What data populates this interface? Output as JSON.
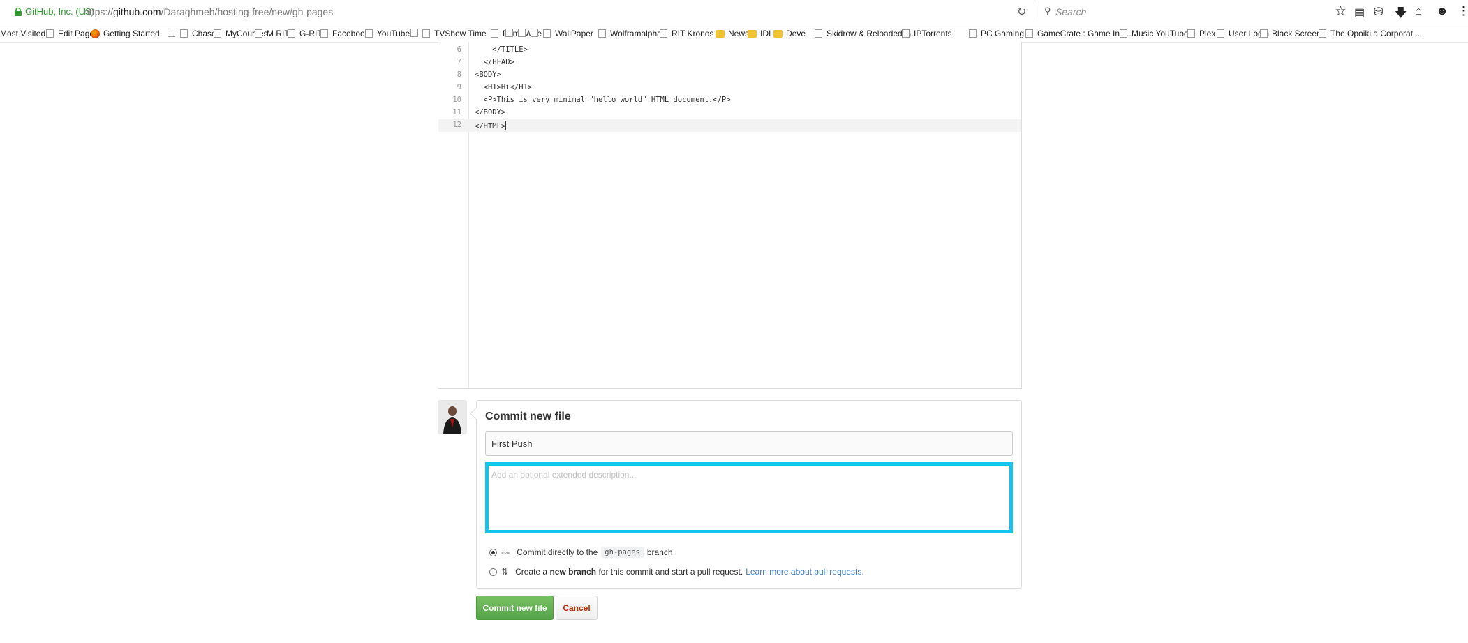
{
  "browser": {
    "site_identity": "GitHub, Inc. (US)",
    "url_prefix": "https://",
    "url_host": "github.com",
    "url_path": "/Daraghmeh/hosting-free/new/gh-pages",
    "search_placeholder": "Search",
    "toolbar_icons": [
      "bookmark-star-icon",
      "reading-list-icon",
      "pocket-icon",
      "downloads-icon",
      "home-icon",
      "hello-icon"
    ]
  },
  "bookmarks": [
    {
      "label": "Most Visited",
      "icon": "none"
    },
    {
      "label": "Edit Page",
      "icon": "box"
    },
    {
      "label": "Getting Started",
      "icon": "firefox"
    },
    {
      "label": "",
      "icon": "box"
    },
    {
      "label": "Chase",
      "icon": "box"
    },
    {
      "label": "MyCourses",
      "icon": "box"
    },
    {
      "label": "M RIT",
      "icon": "box"
    },
    {
      "label": "G-RIT",
      "icon": "box"
    },
    {
      "label": "Facebook",
      "icon": "box"
    },
    {
      "label": "YouTube",
      "icon": "box"
    },
    {
      "label": "",
      "icon": "box"
    },
    {
      "label": "TVShow Time",
      "icon": "box"
    },
    {
      "label": "PrimeWire",
      "icon": "box"
    },
    {
      "label": "",
      "icon": "box"
    },
    {
      "label": "",
      "icon": "box"
    },
    {
      "label": "",
      "icon": "box"
    },
    {
      "label": "WallPaper",
      "icon": "box"
    },
    {
      "label": "Wolframalpha",
      "icon": "box"
    },
    {
      "label": "RIT Kronos",
      "icon": "box"
    },
    {
      "label": "News",
      "icon": "folder"
    },
    {
      "label": "IDI",
      "icon": "folder"
    },
    {
      "label": "Deve",
      "icon": "folder"
    },
    {
      "label": "Skidrow & Reloaded G...",
      "icon": "box"
    },
    {
      "label": "IPTorrents",
      "icon": "box"
    },
    {
      "label": "PC Gaming",
      "icon": "box"
    },
    {
      "label": "GameCrate : Game Ind...",
      "icon": "box"
    },
    {
      "label": "Music YouTube",
      "icon": "box"
    },
    {
      "label": "Plex",
      "icon": "box"
    },
    {
      "label": "User Login",
      "icon": "box"
    },
    {
      "label": "Black Screen",
      "icon": "box"
    },
    {
      "label": "The Opoiki a Corporat...",
      "icon": "box"
    }
  ],
  "editor": {
    "lines": [
      {
        "num": "6",
        "text": "    </TITLE>"
      },
      {
        "num": "7",
        "text": "  </HEAD>"
      },
      {
        "num": "8",
        "text": "<BODY>"
      },
      {
        "num": "9",
        "text": "  <H1>Hi</H1>"
      },
      {
        "num": "10",
        "text": "  <P>This is very minimal \"hello world\" HTML document.</P>"
      },
      {
        "num": "11",
        "text": "</BODY>"
      },
      {
        "num": "12",
        "text": "</HTML>"
      }
    ]
  },
  "commit": {
    "title": "Commit new file",
    "summary_value": "First Push",
    "description_placeholder": "Add an optional extended description...",
    "option_direct_prefix": "Commit directly to the",
    "branch_name": "gh-pages",
    "option_direct_suffix": "branch",
    "option_new_prefix": "Create a",
    "option_new_bold": "new branch",
    "option_new_suffix": "for this commit and start a pull request.",
    "learn_more_link": "Learn more about pull requests.",
    "selected_option": "direct",
    "submit_label": "Commit new file",
    "cancel_label": "Cancel"
  },
  "colors": {
    "focus_border": "#15c3ef",
    "primary_button": "#55a44a",
    "cancel_text": "#bd2c00",
    "link": "#4078c0"
  }
}
